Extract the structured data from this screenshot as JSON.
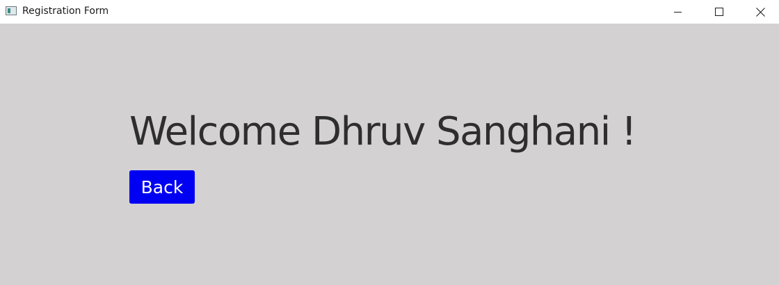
{
  "window": {
    "title": "Registration Form",
    "controls": [
      "minimize-icon",
      "maximize-icon",
      "close-icon"
    ]
  },
  "main": {
    "welcome_text": "Welcome Dhruv Sanghani !",
    "back_label": "Back"
  },
  "colors": {
    "background": "#d3d1d2",
    "titlebar": "#ffffff",
    "button": "#0000f3",
    "button_text": "#ffffff",
    "text": "#2e2e2e"
  }
}
